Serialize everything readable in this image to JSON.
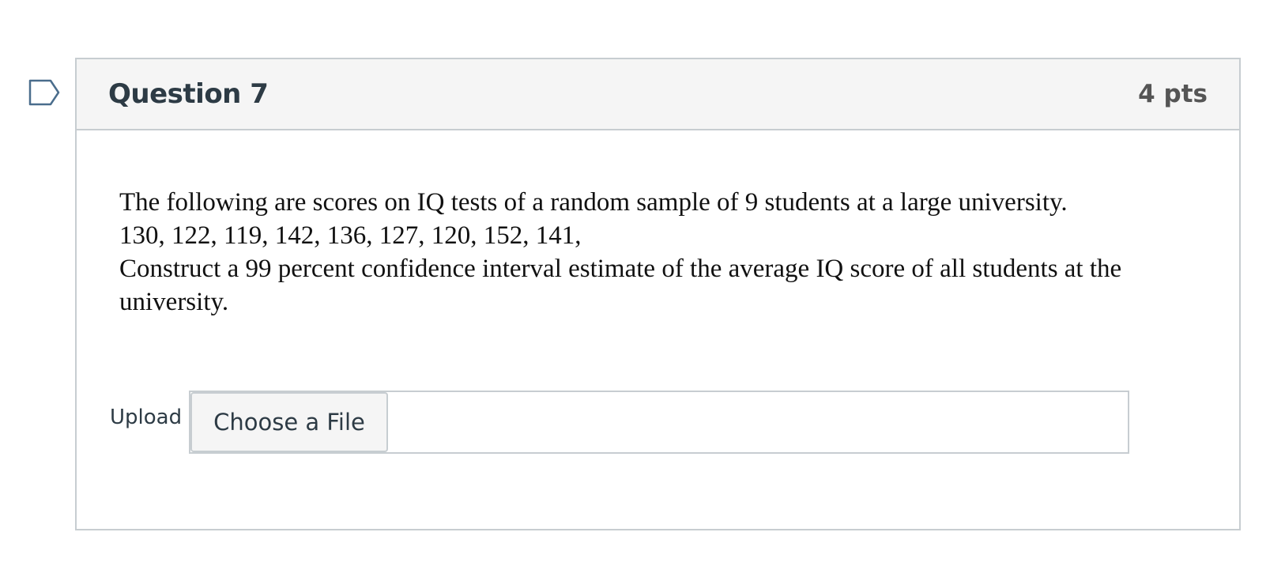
{
  "question": {
    "flag_icon": "bookmark-flag-icon",
    "title": "Question 7",
    "points": "4 pts",
    "text_lines": [
      "The following are scores on IQ tests of a random sample of 9 students at a large university.",
      "130, 122, 119, 142, 136, 127, 120, 152, 141,",
      "Construct a 99 percent confidence interval estimate of the average IQ score of all students at the",
      "university."
    ],
    "upload": {
      "label": "Upload",
      "button_label": "Choose a File"
    }
  },
  "colors": {
    "header_bg": "#f5f5f5",
    "border": "#c7cdd1",
    "title_text": "#2d3b45",
    "points_text": "#555555",
    "flag_stroke": "#4a6d8c"
  }
}
